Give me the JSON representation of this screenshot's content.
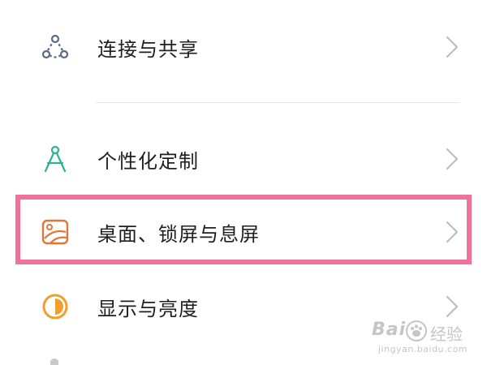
{
  "settings_list": {
    "items": [
      {
        "id": "connect",
        "label": "连接与共享",
        "icon": "share-nodes-icon",
        "icon_color": "#5b6a85"
      },
      {
        "id": "personal",
        "label": "个性化定制",
        "icon": "compass-drafting-icon",
        "icon_color": "#2bb394"
      },
      {
        "id": "desktop",
        "label": "桌面、锁屏与息屏",
        "icon": "wallpaper-icon",
        "icon_color": "#e0763a"
      },
      {
        "id": "display",
        "label": "显示与亮度",
        "icon": "brightness-half-circle-icon",
        "icon_color": "#f0a02a"
      }
    ],
    "highlighted_item": "desktop"
  },
  "colors": {
    "highlight_border": "#f0729b",
    "chevron": "#bdbdbd",
    "divider": "#e6e6e6",
    "text": "#1f1f1f"
  },
  "watermark": {
    "brand": "Bai",
    "suffix": "经验",
    "url": "jingyan.baidu.com"
  }
}
